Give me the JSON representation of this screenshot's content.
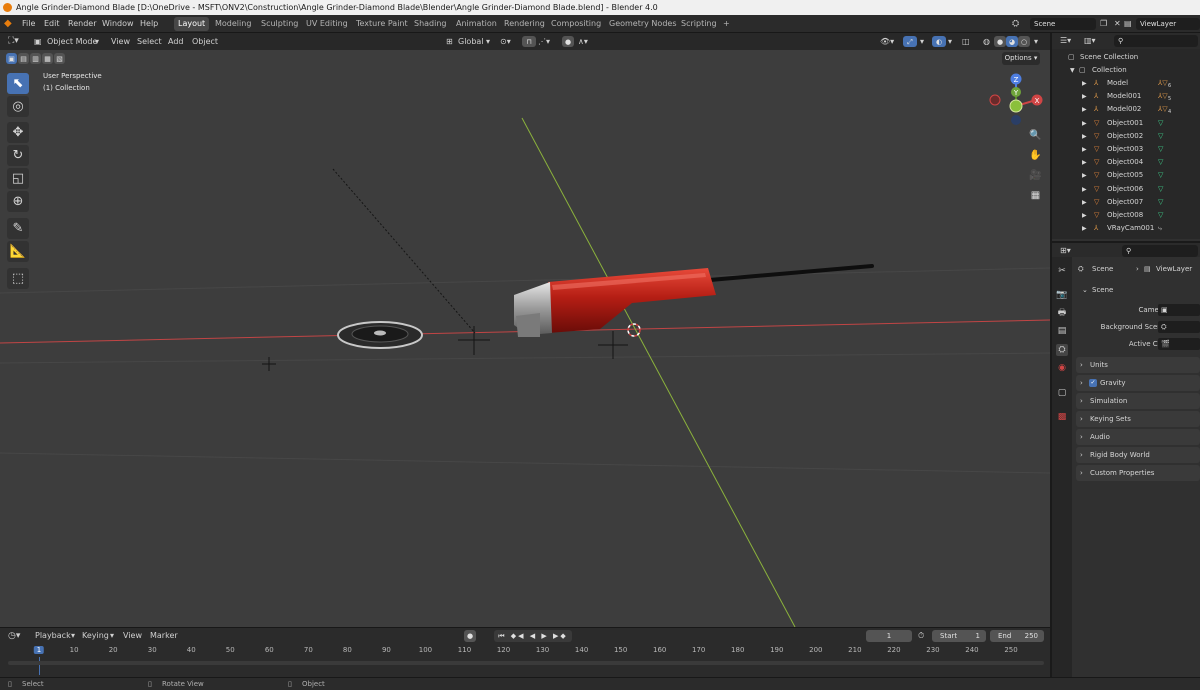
{
  "window": {
    "title": "Angle Grinder-Diamond Blade [D:\\OneDrive - MSFT\\ONV2\\Construction\\Angle Grinder-Diamond Blade\\Blender\\Angle Grinder-Diamond Blade.blend] - Blender 4.0"
  },
  "menu": [
    "File",
    "Edit",
    "Render",
    "Window",
    "Help"
  ],
  "workspaces": [
    "Layout",
    "Modeling",
    "Sculpting",
    "UV Editing",
    "Texture Paint",
    "Shading",
    "Animation",
    "Rendering",
    "Compositing",
    "Geometry Nodes",
    "Scripting",
    "+"
  ],
  "topbar": {
    "scene": "Scene",
    "view_layer": "ViewLayer"
  },
  "viewport_header": {
    "mode": "Object Mode",
    "menus": [
      "View",
      "Select",
      "Add",
      "Object"
    ],
    "transform_orientation": "Global",
    "options": "Options"
  },
  "viewport_overlay": {
    "perspective": "User Perspective",
    "collection": "(1) Collection"
  },
  "gizmo": {
    "z": "Z",
    "y": "Y",
    "x": "X"
  },
  "tools": [
    "select-box",
    "cursor",
    "move",
    "rotate",
    "scale",
    "transform",
    "annotate",
    "measure",
    "add-cube"
  ],
  "outliner": {
    "root": "Scene Collection",
    "collection": "Collection",
    "items": [
      {
        "name": "Model",
        "sub": "6"
      },
      {
        "name": "Model001",
        "sub": "5"
      },
      {
        "name": "Model002",
        "sub": "4"
      },
      {
        "name": "Object001",
        "sub": ""
      },
      {
        "name": "Object002",
        "sub": ""
      },
      {
        "name": "Object003",
        "sub": ""
      },
      {
        "name": "Object004",
        "sub": ""
      },
      {
        "name": "Object005",
        "sub": ""
      },
      {
        "name": "Object006",
        "sub": ""
      },
      {
        "name": "Object007",
        "sub": ""
      },
      {
        "name": "Object008",
        "sub": ""
      },
      {
        "name": "VRayCam001",
        "sub": ""
      }
    ]
  },
  "properties": {
    "breadcrumb_scene": "Scene",
    "breadcrumb_layer": "ViewLayer",
    "panel_scene": "Scene",
    "camera_label": "Camera",
    "bg_scene_label": "Background Scene",
    "active_clip_label": "Active Clip",
    "panels": [
      "Units",
      "Gravity",
      "Simulation",
      "Keying Sets",
      "Audio",
      "Rigid Body World",
      "Custom Properties"
    ]
  },
  "timeline": {
    "menus": [
      "Playback",
      "Keying",
      "View",
      "Marker"
    ],
    "current_frame": "1",
    "start_label": "Start",
    "start": "1",
    "end_label": "End",
    "end": "250",
    "ticks": [
      "1",
      "10",
      "20",
      "30",
      "40",
      "50",
      "60",
      "70",
      "80",
      "90",
      "100",
      "110",
      "120",
      "130",
      "140",
      "150",
      "160",
      "170",
      "180",
      "190",
      "200",
      "210",
      "220",
      "230",
      "240",
      "250"
    ]
  },
  "statusbar": {
    "select": "Select",
    "rotate": "Rotate View",
    "object": "Object"
  },
  "colors": {
    "accent": "#4772b3",
    "axis_x": "#c14545",
    "axis_y": "#8bb23c",
    "grinder_red": "#b51e14"
  }
}
